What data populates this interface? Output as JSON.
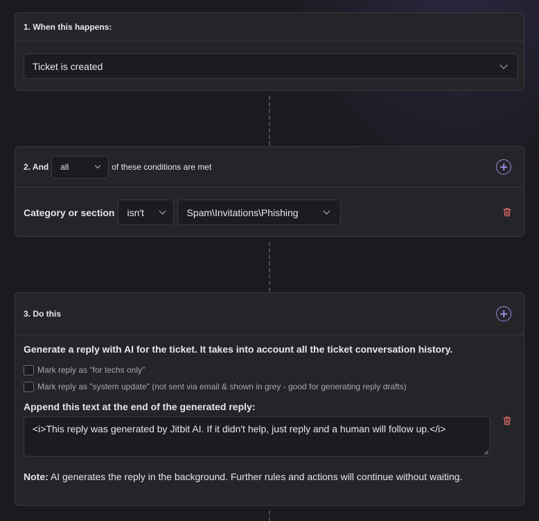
{
  "step1": {
    "title": "1. When this happens:",
    "trigger_value": "Ticket is created"
  },
  "step2": {
    "title_prefix": "2. And",
    "match_value": "all",
    "title_suffix": "of these conditions are met",
    "condition": {
      "field_label": "Category or section",
      "operator": "isn't",
      "value": "Spam\\Invitations\\Phishing"
    }
  },
  "step3": {
    "title": "3. Do this",
    "description": "Generate a reply with AI for the ticket. It takes into account all the ticket conversation history.",
    "checkbox1_label": "Mark reply as \"for techs only\"",
    "checkbox2_label": "Mark reply as \"system update\" (not sent via email & shown in grey - good for generating reply drafts)",
    "append_label": "Append this text at the end of the generated reply:",
    "append_text": "<i>This reply was generated by Jitbit AI. If it didn't help, just reply and a human will follow up.</i>",
    "note_label": "Note:",
    "note_text": " AI generates the reply in the background. Further rules and actions will continue without waiting."
  },
  "colors": {
    "accent": "#9a8ee8",
    "danger": "#e06a6a",
    "card_bg": "#252429",
    "page_bg": "#1b1a1f"
  },
  "icons": [
    "chevron-down-icon",
    "plus-circle-icon",
    "trash-icon"
  ]
}
